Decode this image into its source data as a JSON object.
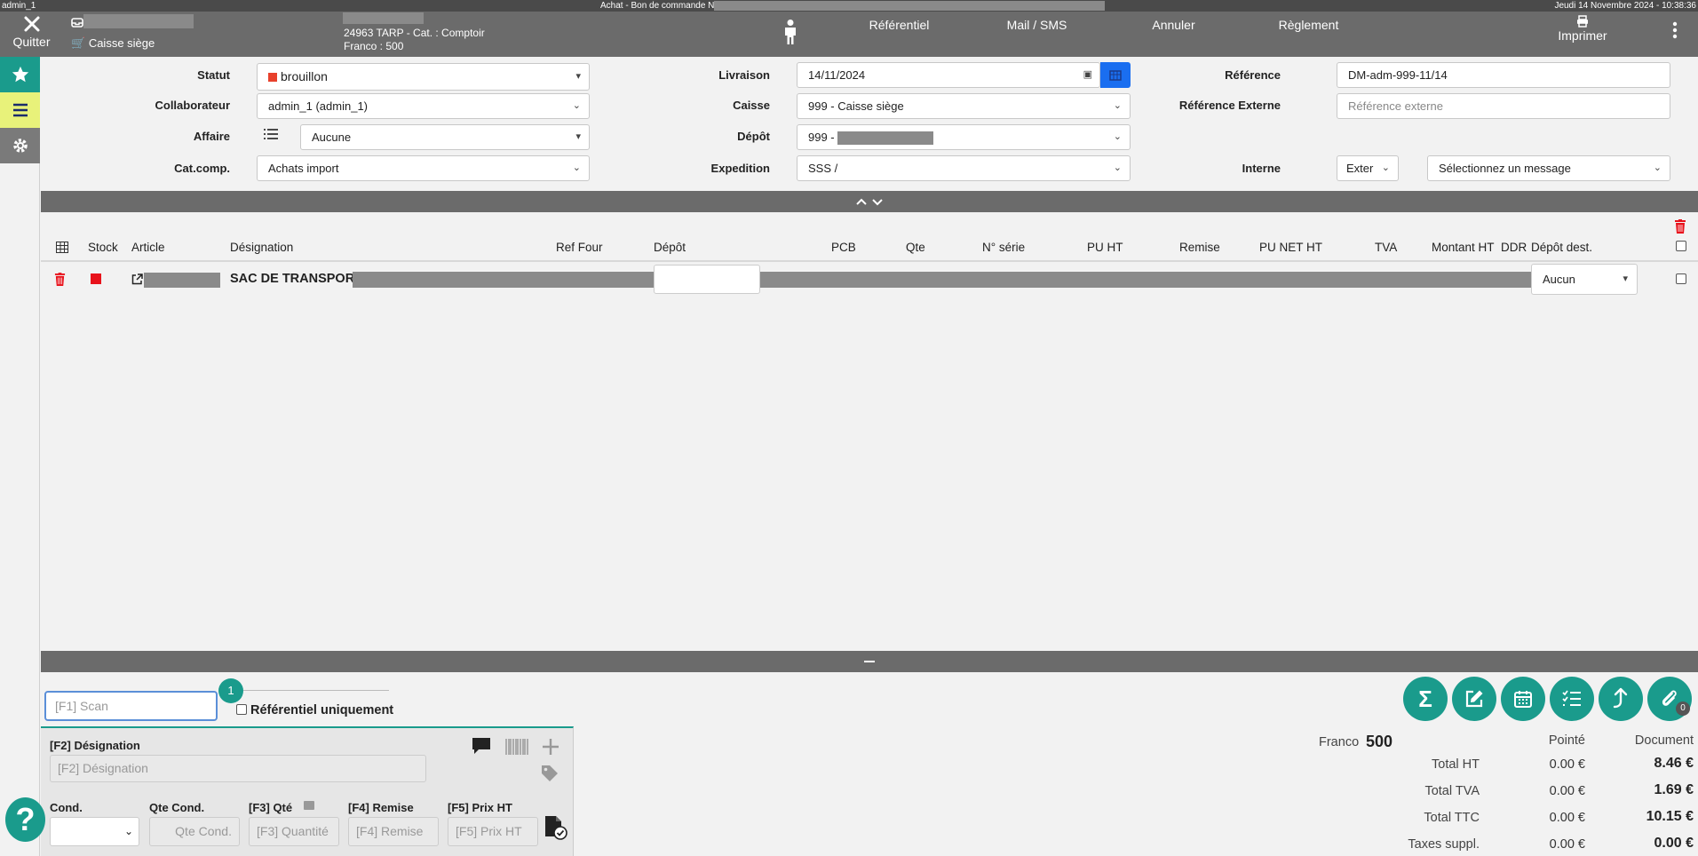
{
  "sysbar": {
    "user": "admin_1",
    "title": "Achat - Bon de commande N",
    "datetime": "Jeudi 14 Novembre 2024 - 10:38:36"
  },
  "topbar": {
    "quit_label": "Quitter",
    "register_label": "Caisse siège",
    "supplier_line1": "24963 TARP - Cat. : Comptoir",
    "supplier_line2": "Franco : 500",
    "menu": [
      "Référentiel",
      "Mail / SMS",
      "Annuler",
      "Règlement"
    ],
    "print_label": "Imprimer"
  },
  "header": {
    "statut": {
      "label": "Statut",
      "value": "brouillon",
      "color": "#e8412c"
    },
    "collaborateur": {
      "label": "Collaborateur",
      "value": "admin_1 (admin_1)"
    },
    "affaire": {
      "label": "Affaire",
      "value": "Aucune"
    },
    "catcomp": {
      "label": "Cat.comp.",
      "value": "Achats import"
    },
    "livraison": {
      "label": "Livraison",
      "value": "14/11/2024"
    },
    "caisse": {
      "label": "Caisse",
      "value": "999 - Caisse siège"
    },
    "depot": {
      "label": "Dépôt",
      "value": "999 -"
    },
    "expedition": {
      "label": "Expedition",
      "value": "SSS /"
    },
    "reference": {
      "label": "Référence",
      "value": "DM-adm-999-11/14"
    },
    "reference_externe": {
      "label": "Référence Externe",
      "placeholder": "Référence externe"
    },
    "interne": {
      "label": "Interne",
      "value": "Exter",
      "message": "Sélectionnez un message"
    }
  },
  "table": {
    "columns": [
      "Stock",
      "Article",
      "Désignation",
      "Ref Four",
      "Dépôt",
      "PCB",
      "Qte",
      "N° série",
      "PU HT",
      "Remise",
      "PU NET HT",
      "TVA",
      "Montant HT",
      "DDR",
      "Dépôt dest."
    ],
    "rows": [
      {
        "designation": "SAC DE TRANSPORT",
        "stock_color": "#e8121b",
        "depot_dest": "Aucun"
      }
    ]
  },
  "bottom": {
    "scan_placeholder": "[F1] Scan",
    "badge": "1",
    "referentiel_label": "Référentiel uniquement",
    "designation_label": "[F2] Désignation",
    "designation_placeholder": "[F2] Désignation",
    "cond_label": "Cond.",
    "qtecond_label": "Qte Cond.",
    "qtecond_placeholder": "Qte Cond.",
    "qte_label": "[F3] Qté",
    "qte_placeholder": "[F3] Quantité",
    "remise_label": "[F4] Remise",
    "remise_placeholder": "[F4] Remise",
    "prix_label": "[F5] Prix HT",
    "prix_placeholder": "[F5] Prix HT",
    "attach_count": "0",
    "help": "?"
  },
  "totals": {
    "franco_label": "Franco",
    "franco_value": "500",
    "col_pointe": "Pointé",
    "col_document": "Document",
    "rows": [
      {
        "label": "Total HT",
        "pointe": "0.00 €",
        "document": "8.46 €"
      },
      {
        "label": "Total TVA",
        "pointe": "0.00 €",
        "document": "1.69 €"
      },
      {
        "label": "Total TTC",
        "pointe": "0.00 €",
        "document": "10.15 €"
      },
      {
        "label": "Taxes suppl.",
        "pointe": "0.00 €",
        "document": "0.00 €"
      }
    ]
  },
  "colors": {
    "topbar": "#6b6b6b",
    "accent": "#1a9b8c",
    "sidebar_active": "#e8f27a",
    "blue": "#1a6ef0",
    "orange": "#f07d16",
    "red": "#e8412c"
  }
}
